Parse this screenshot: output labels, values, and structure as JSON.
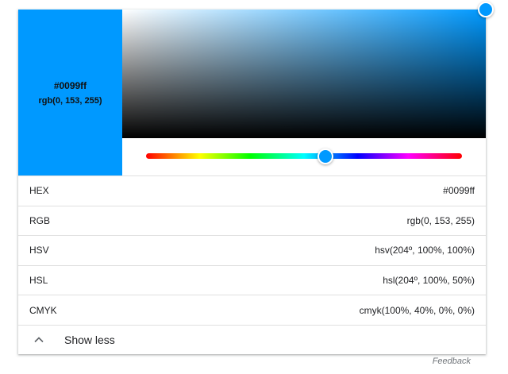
{
  "colors": {
    "selected": "#0099ff"
  },
  "swatch": {
    "hex": "#0099ff",
    "rgb": "rgb(0, 153, 255)"
  },
  "hue_fraction": 0.568,
  "saturation_fraction": 1.0,
  "value_fraction": 1.0,
  "rows": [
    {
      "label": "HEX",
      "value": "#0099ff"
    },
    {
      "label": "RGB",
      "value": "rgb(0, 153, 255)"
    },
    {
      "label": "HSV",
      "value": "hsv(204º, 100%, 100%)"
    },
    {
      "label": "HSL",
      "value": "hsl(204º, 100%, 50%)"
    },
    {
      "label": "CMYK",
      "value": "cmyk(100%, 40%, 0%, 0%)"
    }
  ],
  "show_less_label": "Show less",
  "feedback_label": "Feedback",
  "icons": {
    "chevron": "chevron-up-icon"
  }
}
